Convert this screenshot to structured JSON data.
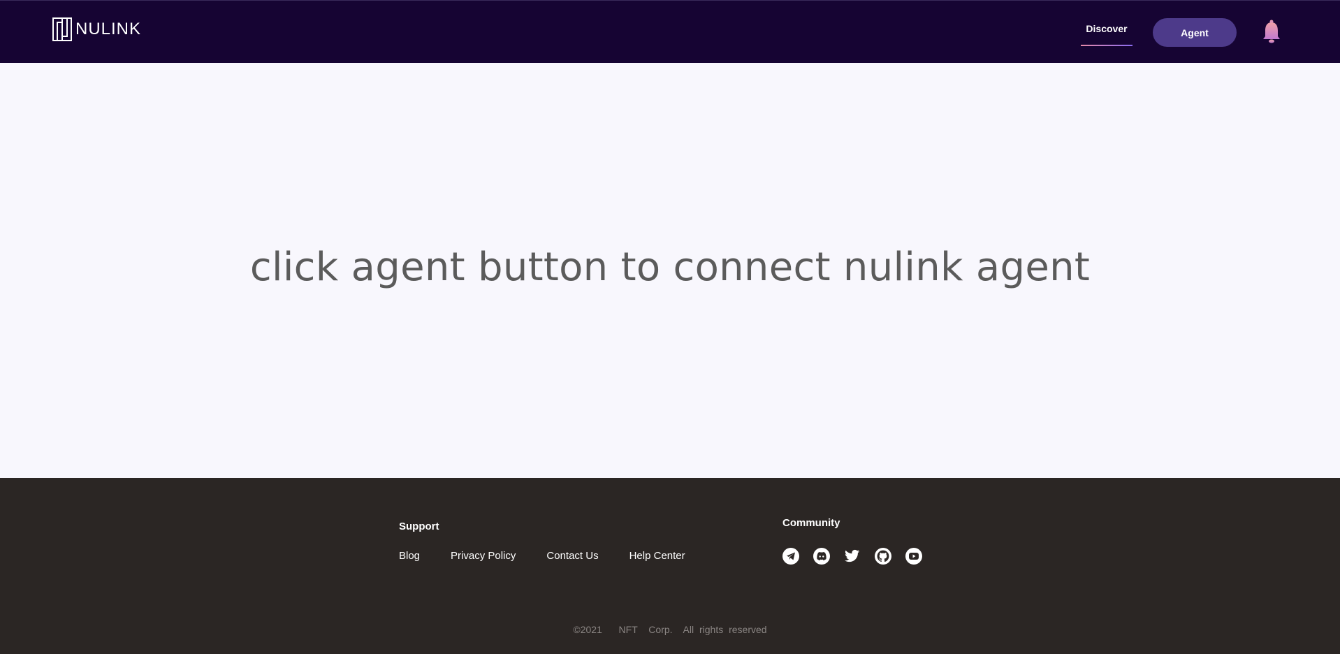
{
  "header": {
    "logo_text": "NULINK",
    "nav_discover": "Discover",
    "agent_button": "Agent"
  },
  "main": {
    "message": "click agent button to connect nulink agent"
  },
  "footer": {
    "support_title": "Support",
    "support_links": [
      "Blog",
      "Privacy Policy",
      "Contact Us",
      "Help Center"
    ],
    "community_title": "Community",
    "community_icons": [
      "telegram-icon",
      "discord-icon",
      "twitter-icon",
      "github-icon",
      "youtube-icon"
    ],
    "copyright": "©2021   NFT  Corp.  All rights reserved"
  },
  "colors": {
    "header_bg": "#160433",
    "agent_button_bg": "#4d3a8a",
    "main_bg": "#f8f7fd",
    "footer_bg": "#2b2624"
  }
}
